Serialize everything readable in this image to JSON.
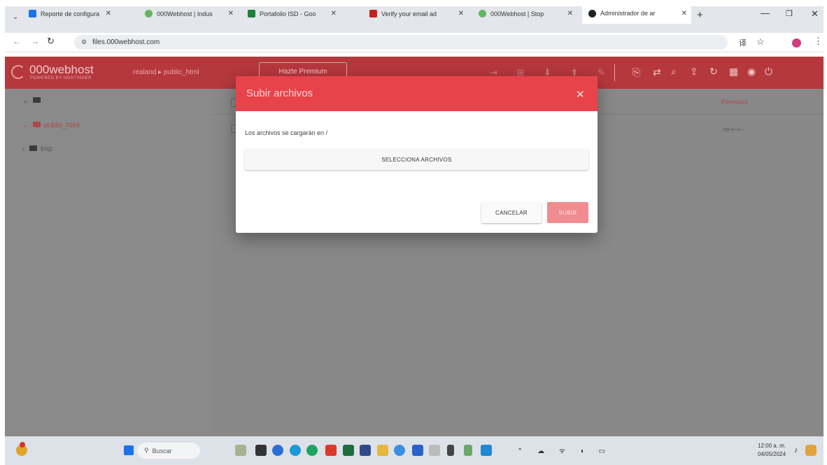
{
  "browser": {
    "tabs": [
      {
        "title": "Reporte de configura",
        "color": "#1a73e8"
      },
      {
        "title": "000Webhost | Indus",
        "color": "#5fb85f"
      },
      {
        "title": "Portafolio ISD - Goo",
        "color": "#188038"
      },
      {
        "title": "Verify your email ad",
        "color": "#c5221f"
      },
      {
        "title": "000Webhost | Stop",
        "color": "#5fb85f"
      },
      {
        "title": "Administrador de ar",
        "color": "#202124"
      }
    ],
    "new_tab": "+",
    "address": "files.000webhost.com"
  },
  "app": {
    "logo_text": "000webhost",
    "logo_sub": "POWERED BY HOSTINGER",
    "breadcrumb": "realand  ▸  public_html",
    "upgrade_label": "Hazte Premium"
  },
  "tree": {
    "root_icon": "folder-icon",
    "items": [
      {
        "label": "public_html"
      },
      {
        "label": "tmp"
      }
    ]
  },
  "table": {
    "permissions_header": "Permisos",
    "permissions_value": "rw-r--r--"
  },
  "dialog": {
    "title": "Subir archivos",
    "close": "✕",
    "message": "Los archivos se cargarán en /",
    "select_label": "SELECCIONA ARCHIVOS",
    "cancel_label": "CANCELAR",
    "upload_label": "SUBIR"
  },
  "taskbar": {
    "search_placeholder": "Buscar",
    "time": "12:00 a. m.",
    "date": "04/05/2024"
  },
  "colors": {
    "brand": "#b5383d",
    "dialog_header": "#e8434a",
    "upload_button": "#f08c8f"
  }
}
